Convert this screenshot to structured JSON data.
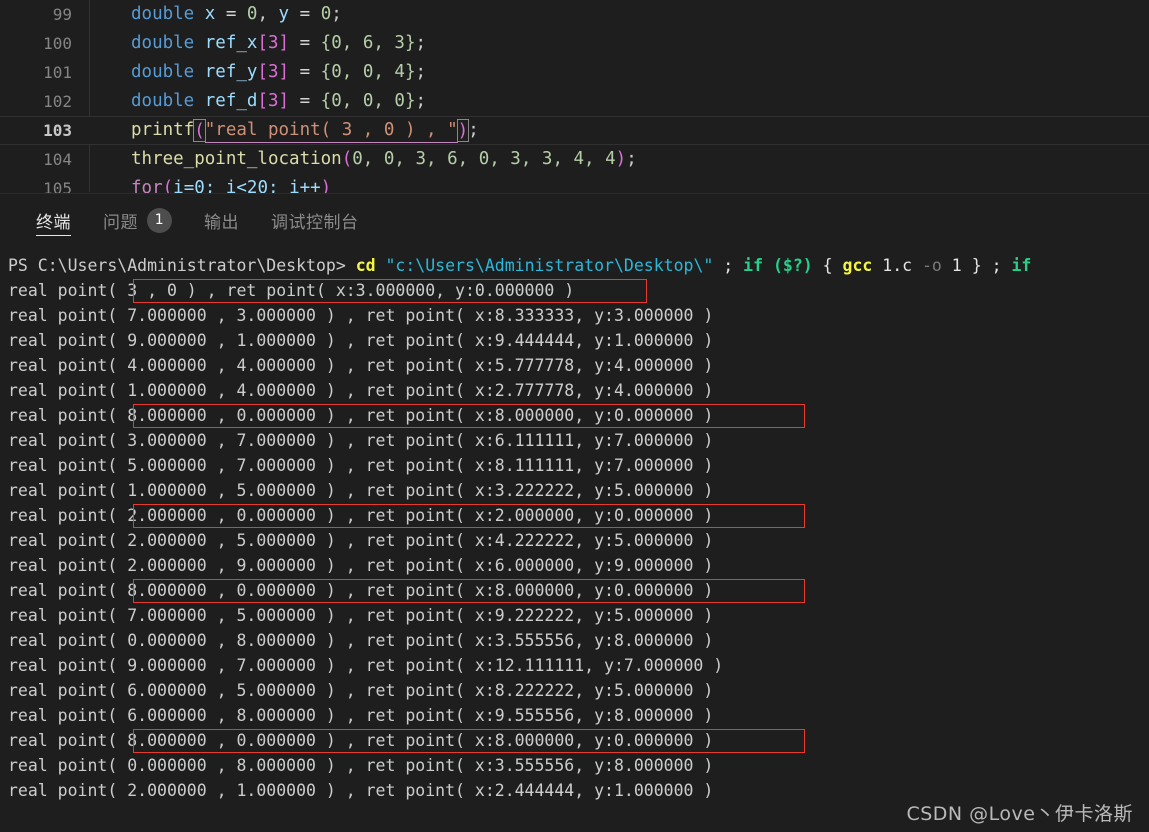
{
  "editor": {
    "lines": [
      {
        "number": "99",
        "active": false
      },
      {
        "number": "100",
        "active": false
      },
      {
        "number": "101",
        "active": false
      },
      {
        "number": "102",
        "active": false
      },
      {
        "number": "103",
        "active": true
      },
      {
        "number": "104",
        "active": false
      },
      {
        "number": "105",
        "active": false
      }
    ],
    "code": {
      "l99": "double x = 0, y = 0;",
      "l100": "double ref_x[3] = {0, 6, 3};",
      "l101": "double ref_y[3] = {0, 0, 4};",
      "l102": "double ref_d[3] = {0, 0, 0};",
      "l103": "printf(\"real point( 3 , 0 ) , \");",
      "l104": "three_point_location(0, 0, 3, 6, 0, 3, 3, 4, 4);",
      "l105": "for(i=0; i<20; i++)",
      "tokens": {
        "kw_double": "double",
        "var_x": "x",
        "var_y": "y",
        "var_ref_x": "ref_x",
        "var_ref_y": "ref_y",
        "var_ref_d": "ref_d",
        "fn_printf": "printf",
        "fn_three_point_location": "three_point_location",
        "kw_for": "for",
        "var_i": "i",
        "str_printf": "\"real point( 3 , 0 ) , \"",
        "eq": " = ",
        "semi": ";",
        "open_paren": "(",
        "close_paren": ")",
        "arr3": "[3]",
        "init_x": "{0, 6, 3}",
        "init_y": "{0, 0, 4}",
        "init_d": "{0, 0, 0}",
        "zero": "0",
        "args_tpl": "0, 0, 3, 6, 0, 3, 3, 4, 4",
        "for_init": "i=0; ",
        "for_cond": "i<20; ",
        "for_inc": "i++"
      }
    }
  },
  "panel": {
    "tabs": [
      {
        "label": "终端",
        "active": true,
        "badge": null
      },
      {
        "label": "问题",
        "active": false,
        "badge": "1"
      },
      {
        "label": "输出",
        "active": false,
        "badge": null
      },
      {
        "label": "调试控制台",
        "active": false,
        "badge": null
      }
    ]
  },
  "terminal": {
    "prompt": {
      "ps": "PS C:\\Users\\Administrator\\Desktop> ",
      "cd": "cd ",
      "path": "\"c:\\Users\\Administrator\\Desktop\\\"",
      "sep1": " ; ",
      "if1": "if ",
      "cond1": "($?)",
      "brace_open": " { ",
      "gcc": "gcc",
      "src": " 1.c ",
      "flag": "-o",
      "out": " 1 ",
      "brace_close": "} ",
      "sep2": "; ",
      "if2": "if"
    },
    "lines": [
      {
        "text": "real point( 3 , 0 ) , ret point( x:3.000000, y:0.000000 )",
        "boxed": "partial"
      },
      {
        "text": "real point( 7.000000 , 3.000000 ) , ret point( x:8.333333, y:3.000000 )",
        "boxed": "none"
      },
      {
        "text": "real point( 9.000000 , 1.000000 ) , ret point( x:9.444444, y:1.000000 )",
        "boxed": "none"
      },
      {
        "text": "real point( 4.000000 , 4.000000 ) , ret point( x:5.777778, y:4.000000 )",
        "boxed": "none"
      },
      {
        "text": "real point( 1.000000 , 4.000000 ) , ret point( x:2.777778, y:4.000000 )",
        "boxed": "none"
      },
      {
        "text": "real point( 8.000000 , 0.000000 ) , ret point( x:8.000000, y:0.000000 )",
        "boxed": "full"
      },
      {
        "text": "real point( 3.000000 , 7.000000 ) , ret point( x:6.111111, y:7.000000 )",
        "boxed": "none"
      },
      {
        "text": "real point( 5.000000 , 7.000000 ) , ret point( x:8.111111, y:7.000000 )",
        "boxed": "none"
      },
      {
        "text": "real point( 1.000000 , 5.000000 ) , ret point( x:3.222222, y:5.000000 )",
        "boxed": "none"
      },
      {
        "text": "real point( 2.000000 , 0.000000 ) , ret point( x:2.000000, y:0.000000 )",
        "boxed": "full"
      },
      {
        "text": "real point( 2.000000 , 5.000000 ) , ret point( x:4.222222, y:5.000000 )",
        "boxed": "none"
      },
      {
        "text": "real point( 2.000000 , 9.000000 ) , ret point( x:6.000000, y:9.000000 )",
        "boxed": "none"
      },
      {
        "text": "real point( 8.000000 , 0.000000 ) , ret point( x:8.000000, y:0.000000 )",
        "boxed": "full"
      },
      {
        "text": "real point( 7.000000 , 5.000000 ) , ret point( x:9.222222, y:5.000000 )",
        "boxed": "none"
      },
      {
        "text": "real point( 0.000000 , 8.000000 ) , ret point( x:3.555556, y:8.000000 )",
        "boxed": "none"
      },
      {
        "text": "real point( 9.000000 , 7.000000 ) , ret point( x:12.111111, y:7.000000 )",
        "boxed": "none"
      },
      {
        "text": "real point( 6.000000 , 5.000000 ) , ret point( x:8.222222, y:5.000000 )",
        "boxed": "none"
      },
      {
        "text": "real point( 6.000000 , 8.000000 ) , ret point( x:9.555556, y:8.000000 )",
        "boxed": "none"
      },
      {
        "text": "real point( 8.000000 , 0.000000 ) , ret point( x:8.000000, y:0.000000 )",
        "boxed": "full"
      },
      {
        "text": "real point( 0.000000 , 8.000000 ) , ret point( x:3.555556, y:8.000000 )",
        "boxed": "none"
      },
      {
        "text": "real point( 2.000000 , 1.000000 ) , ret point( x:2.444444, y:1.000000 )",
        "boxed": "none"
      }
    ]
  },
  "watermark": "CSDN @Love丶伊卡洛斯",
  "colors": {
    "editor_bg": "#1e1e1e",
    "terminal_bg": "#1e1e1e",
    "annotation_red": "#e83a2e",
    "accent_green": "#23d18b",
    "accent_cyan": "#29b8db",
    "accent_yellow": "#f5f543"
  }
}
